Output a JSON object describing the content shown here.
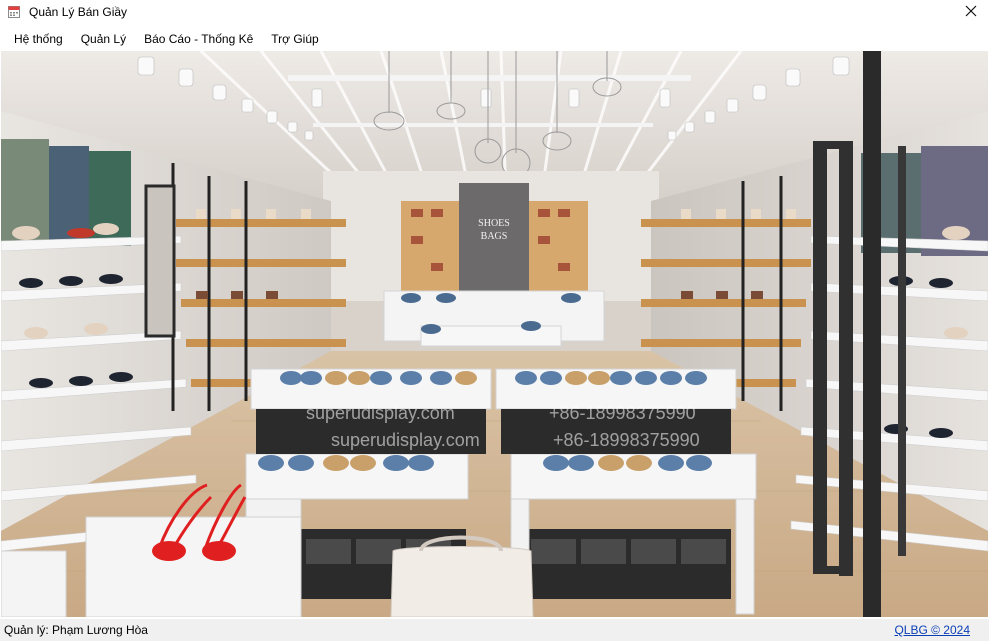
{
  "window": {
    "title": "Quản Lý Bán Giầy",
    "app_icon": "calendar-icon",
    "close_icon": "close-icon"
  },
  "menu": {
    "items": [
      {
        "label": "Hệ thống"
      },
      {
        "label": "Quản Lý"
      },
      {
        "label": "Báo Cáo - Thống Kê"
      },
      {
        "label": "Trợ Giúp"
      }
    ]
  },
  "banner": {
    "store_sign": "SHOES BAGS",
    "watermark_site": "superudisplay.com",
    "watermark_phone": "+86-18998375990"
  },
  "status": {
    "user_label": "Quản lý: Phạm Lương Hòa",
    "copyright_link": "QLBG © 2024"
  },
  "colors": {
    "accent_red": "#e04040",
    "link_blue": "#0b3fb5",
    "statusbar_bg": "#f0f0f0"
  }
}
